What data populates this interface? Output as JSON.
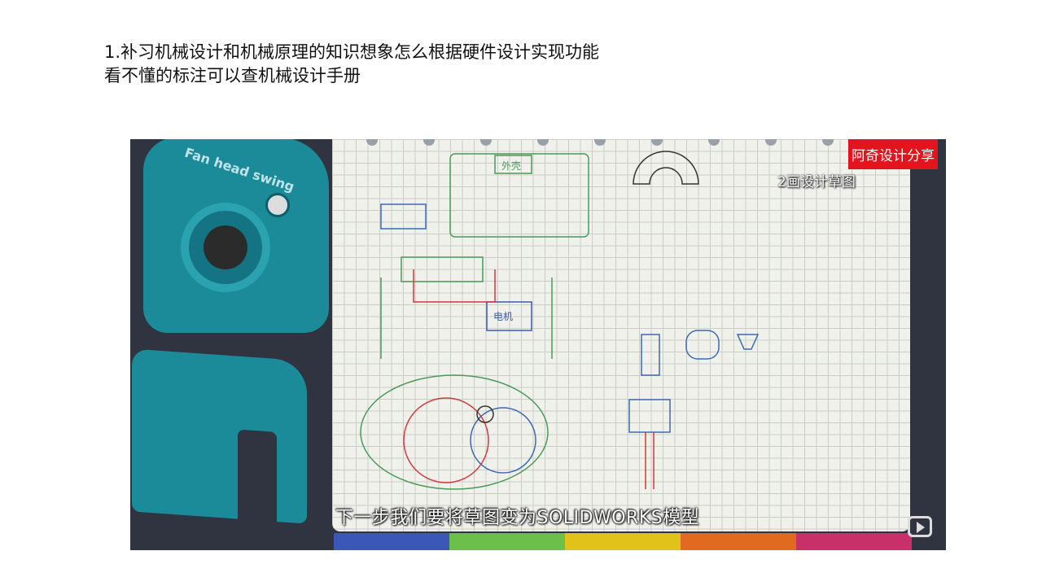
{
  "slide": {
    "line1": "1.补习机械设计和机械原理的知识想象怎么根据硬件设计实现功能",
    "line2": "看不懂的标注可以查机械设计手册"
  },
  "video": {
    "channel_badge": "阿奇设计分享",
    "chapter_caption": "2画设计草图",
    "subtitle": "下一步我们要将草图变为SOLIDWORKS模型",
    "product_label": "Fan head swing",
    "sketch_labels": {
      "motor": "电机",
      "shell": "外壳"
    },
    "colors": {
      "brand": "#e3141b",
      "teal": "#1b8a99"
    }
  }
}
